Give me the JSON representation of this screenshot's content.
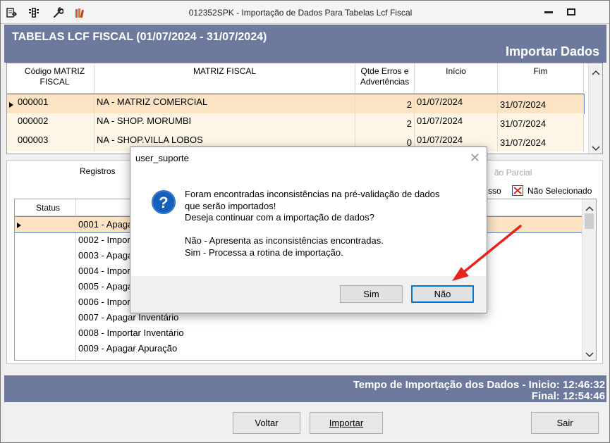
{
  "window": {
    "title": "012352SPK - Importação de Dados Para Tabelas Lcf Fiscal"
  },
  "header": {
    "title": "TABELAS LCF FISCAL (01/07/2024 - 31/07/2024)",
    "action": "Importar Dados"
  },
  "grid1": {
    "columns": [
      "Código MATRIZ FISCAL",
      "MATRIZ FISCAL",
      "Qtde Erros e Advertências",
      "Início",
      "Fim"
    ],
    "rows": [
      {
        "codigo": "000001",
        "matriz": "NA - MATRIZ COMERCIAL",
        "qtde": "2",
        "inicio": "01/07/2024",
        "fim": "31/07/2024"
      },
      {
        "codigo": "000002",
        "matriz": "NA - SHOP. MORUMBI",
        "qtde": "2",
        "inicio": "01/07/2024",
        "fim": "31/07/2024"
      },
      {
        "codigo": "000003",
        "matriz": "NA - SHOP.VILLA LOBOS",
        "qtde": "0",
        "inicio": "01/07/2024",
        "fim": "31/07/2024"
      }
    ]
  },
  "tabs": {
    "registros": "Registros",
    "parcial": "ão Parcial",
    "sucesso_partial": "sso",
    "nao_selecionado": "Não Selecionado"
  },
  "grid2": {
    "status_header": "Status",
    "rows": [
      "0001 - Apagar",
      "0002 - Impor",
      "0003 - Apaga",
      "0004 - Impor",
      "0005 - Apaga",
      "0006 - Impor",
      "0007 - Apagar Inventário",
      "0008 - Importar Inventário",
      "0009 - Apagar Apuração"
    ]
  },
  "statusbar": {
    "line1": "Tempo de Importação dos Dados - Inicio: 12:46:32",
    "line2": "Final: 12:54:46"
  },
  "buttons": {
    "voltar": "Voltar",
    "importar": "Importar",
    "sair": "Sair"
  },
  "dialog": {
    "title": "user_suporte",
    "message": "Foram encontradas inconsistências na pré-validação de dados\nque serão importados!\nDeseja continuar com a importação de dados?\n\nNão - Apresenta as inconsistências encontradas.\nSim - Processa a rotina de importação.",
    "sim": "Sim",
    "nao": "Não"
  },
  "colors": {
    "header_bg": "#6d7a9e",
    "selected_row": "#fbe3c4",
    "row_bg": "#fdf6e6",
    "annotation_arrow": "#e8231d",
    "question_icon": "#1560bd"
  }
}
